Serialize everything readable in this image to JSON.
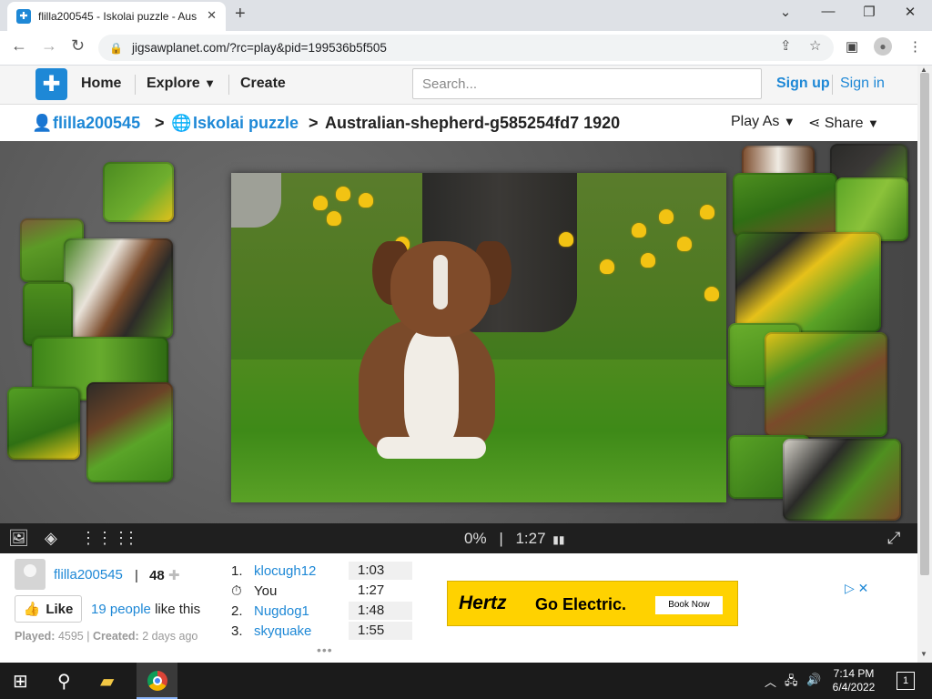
{
  "browser": {
    "tab_title": "flilla200545 - Iskolai puzzle - Aus",
    "url": "jigsawplanet.com/?rc=play&pid=199536b5f505"
  },
  "site": {
    "nav": {
      "home": "Home",
      "explore": "Explore",
      "create": "Create"
    },
    "search_placeholder": "Search...",
    "sign_up": "Sign up",
    "sign_in": "Sign in"
  },
  "breadcrumb": {
    "user": "flilla200545",
    "sep1": ">",
    "collection": "Iskolai puzzle",
    "sep2": ">",
    "puzzle_title": "Australian-shepherd-g585254fd7 1920",
    "play_as": "Play As",
    "share": "Share"
  },
  "toolbar": {
    "progress": "0%",
    "separator": "|",
    "timer": "1:27"
  },
  "author": {
    "name": "flilla200545",
    "separator": "|",
    "pieces": "48"
  },
  "likes": {
    "button": "Like",
    "count_link": "19 people",
    "suffix": "like this"
  },
  "meta": {
    "played_label": "Played:",
    "played_value": "4595",
    "separator": "|",
    "created_label": "Created:",
    "created_value": "2 days ago"
  },
  "leaderboard": [
    {
      "rank": "1.",
      "name": "klocugh12",
      "time": "1:03",
      "is_link": true
    },
    {
      "rank": "",
      "name": "You",
      "time": "1:27",
      "is_link": false
    },
    {
      "rank": "2.",
      "name": "Nugdog1",
      "time": "1:48",
      "is_link": true
    },
    {
      "rank": "3.",
      "name": "skyquake",
      "time": "1:55",
      "is_link": true
    }
  ],
  "ad": {
    "brand": "Hertz",
    "text": "Go Electric.",
    "button": "Book Now"
  },
  "taskbar": {
    "time": "7:14 PM",
    "date": "6/4/2022",
    "notifications": "1"
  },
  "colors": {
    "accent": "#1e88d6",
    "ad_background": "#ffd200",
    "board_background": "#5a5a5a"
  }
}
